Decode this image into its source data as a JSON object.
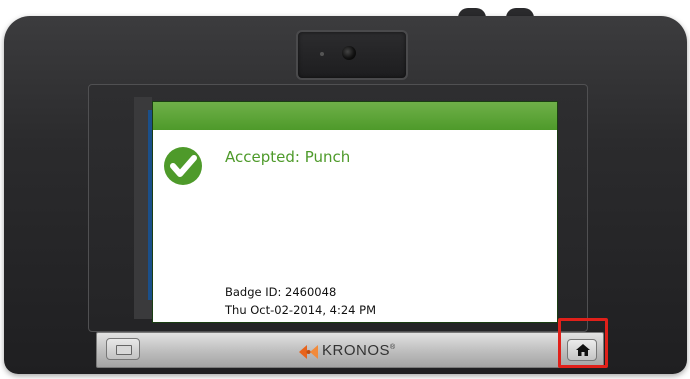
{
  "screen": {
    "status_message": "Accepted: Punch",
    "badge_line": "Badge ID: 2460048",
    "datetime_line": "Thu Oct-02-2014, 4:24 PM"
  },
  "footer": {
    "brand": "KRONOS",
    "brand_mark": "®"
  },
  "icons": {
    "status": "checkmark-circle-icon",
    "home": "home-icon",
    "menu": "menu-icon",
    "camera": "camera-icon"
  },
  "colors": {
    "accent_green": "#4e9a2a",
    "highlight_red": "#e0201a",
    "kronos_orange": "#e8641c"
  }
}
